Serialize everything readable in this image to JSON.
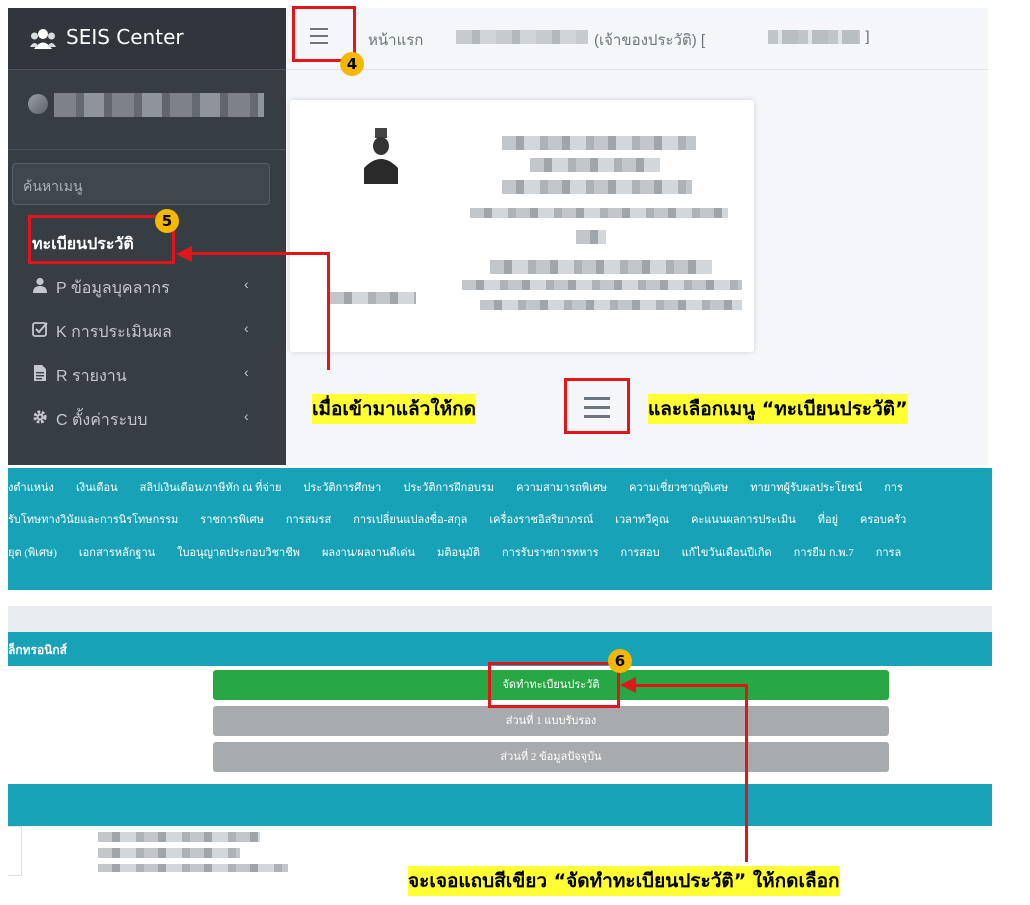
{
  "sidebar": {
    "brand": "SEIS Center",
    "search_placeholder": "ค้นหาเมนู",
    "items": [
      {
        "label": "ทะเบียนประวัติ"
      },
      {
        "label": "P ข้อมูลบุคลากร",
        "chevron": "‹"
      },
      {
        "label": "K การประเมินผล",
        "chevron": "‹"
      },
      {
        "label": "R รายงาน",
        "chevron": "‹"
      },
      {
        "label": "C ตั้งค่าระบบ",
        "chevron": "‹"
      }
    ]
  },
  "topbar": {
    "home": "หน้าแรก",
    "owner": "(เจ้าของประวัติ) [",
    "bracket_close": "]"
  },
  "annotations": {
    "step4": "4",
    "step5": "5",
    "step6": "6",
    "instruction1_a": "เมื่อเข้ามาแล้วให้กด",
    "instruction1_b": "และเลือกเมนู “ทะเบียนประวัติ”",
    "instruction2": "จะเจอแถบสีเขียว “จัดทำทะเบียนประวัติ” ให้กดเลือก"
  },
  "tabs": {
    "row1": [
      "งตำแหน่ง",
      "เงินเดือน",
      "สลิปเงินเดือน/ภาษีหัก ณ ที่จ่าย",
      "ประวัติการศึกษา",
      "ประวัติการฝึกอบรม",
      "ความสามารถพิเศษ",
      "ความเชี่ยวชาญพิเศษ",
      "ทายาทผู้รับผลประโยชน์",
      "การ"
    ],
    "row2": [
      "รับโทษทางวินัยและการนิรโทษกรรม",
      "ราชการพิเศษ",
      "การสมรส",
      "การเปลี่ยนแปลงชื่อ-สกุล",
      "เครื่องราชอิสริยาภรณ์",
      "เวลาทวีคูณ",
      "คะแนนผลการประเมิน",
      "ที่อยู่",
      "ครอบครัว"
    ],
    "row3": [
      "ยุต (พิเศษ)",
      "เอกสารหลักฐาน",
      "ใบอนุญาตประกอบวิชาชีพ",
      "ผลงาน/ผลงานดีเด่น",
      "มติอนุมัติ",
      "การรับราชการทหาร",
      "การสอบ",
      "แก้ไขวันเดือนปีเกิด",
      "การยืม ก.พ.7",
      "การล"
    ]
  },
  "section": {
    "header": "ล็กทรอนิกส์",
    "btn_create": "จัดทำทะเบียนประวัติ",
    "btn_part1": "ส่วนที่ 1 แบบรับรอง",
    "btn_part2": "ส่วนที่ 2 ข้อมูลปัจจุบัน"
  },
  "colors": {
    "sidebar": "#363d43",
    "teal": "#17a2b8",
    "green": "#28a745",
    "gray_button": "#a8abae",
    "annotation_red": "#e0161b",
    "marker_yellow": "#f5b700",
    "highlight": "#ffff33"
  }
}
